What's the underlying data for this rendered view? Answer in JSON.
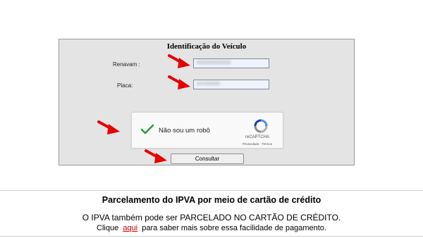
{
  "form": {
    "title": "Identificação do Veículo",
    "renavam_label": "Renavam :",
    "renavam_value": "00000000000",
    "placa_label": "Placa:",
    "placa_value": "XXX0000",
    "submit_label": "Consultar"
  },
  "captcha": {
    "text": "Não sou um robô",
    "brand": "reCAPTCHA",
    "privacy_link": "Privacidade",
    "separator": " - ",
    "terms_link": "Termos",
    "checked": true
  },
  "info": {
    "title": "Parcelamento do IPVA por meio de cartão de crédito",
    "line1": "O IPVA também pode ser PARCELADO NO CARTÃO DE CRÉDITO.",
    "line2_prefix": "Clique",
    "line2_link": "aqui",
    "line2_suffix": "para saber mais sobre essa facilidade de pagamento."
  },
  "colors": {
    "arrow": "#e60000",
    "link": "#cc0000",
    "check": "#2e9a3f",
    "panel_bg": "#e4e4e4"
  },
  "icons": [
    "arrow-right-icon",
    "checkmark-icon",
    "recaptcha-logo-icon"
  ]
}
